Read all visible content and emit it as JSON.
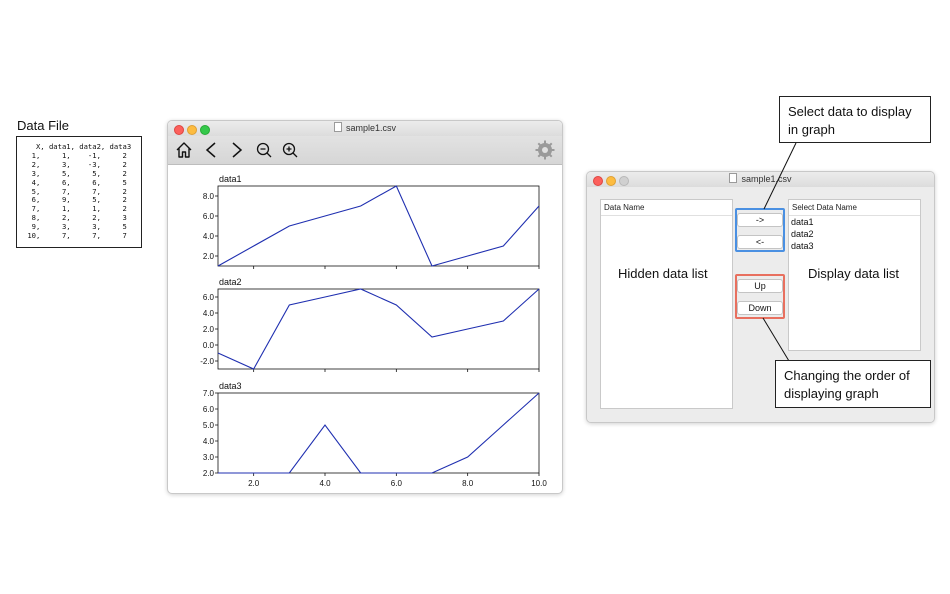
{
  "data_file": {
    "title": "Data File",
    "content": "   X, data1, data2, data3\n  1,     1,    -1,     2\n  2,     3,    -3,     2\n  3,     5,     5,     2\n  4,     6,     6,     5\n  5,     7,     7,     2\n  6,     9,     5,     2\n  7,     1,     1,     2\n  8,     2,     2,     3\n  9,     3,     3,     5\n 10,     7,     7,     7"
  },
  "graph_window": {
    "title": "sample1.csv",
    "toolbar": [
      "home-icon",
      "back-icon",
      "forward-icon",
      "zoom-out-icon",
      "zoom-in-icon",
      "gear-icon"
    ],
    "line_color": "#1f2fb0"
  },
  "chart_data": [
    {
      "type": "line",
      "title": "data1",
      "x": [
        1,
        2,
        3,
        4,
        5,
        6,
        7,
        8,
        9,
        10
      ],
      "values": [
        1,
        3,
        5,
        6,
        7,
        9,
        1,
        2,
        3,
        7
      ],
      "ylim": [
        1,
        9
      ],
      "yticks": [
        "2.0",
        "4.0",
        "6.0",
        "8.0"
      ],
      "ytick_values": [
        2,
        4,
        6,
        8
      ]
    },
    {
      "type": "line",
      "title": "data2",
      "x": [
        1,
        2,
        3,
        4,
        5,
        6,
        7,
        8,
        9,
        10
      ],
      "values": [
        -1,
        -3,
        5,
        6,
        7,
        5,
        1,
        2,
        3,
        7
      ],
      "ylim": [
        -3,
        7
      ],
      "yticks": [
        "-2.0",
        "0.0",
        "2.0",
        "4.0",
        "6.0"
      ],
      "ytick_values": [
        -2,
        0,
        2,
        4,
        6
      ]
    },
    {
      "type": "line",
      "title": "data3",
      "x": [
        1,
        2,
        3,
        4,
        5,
        6,
        7,
        8,
        9,
        10
      ],
      "values": [
        2,
        2,
        2,
        5,
        2,
        2,
        2,
        3,
        5,
        7
      ],
      "ylim": [
        2,
        7
      ],
      "yticks": [
        "2.0",
        "3.0",
        "4.0",
        "5.0",
        "6.0",
        "7.0"
      ],
      "ytick_values": [
        2,
        3,
        4,
        5,
        6,
        7
      ],
      "xticks": [
        "2.0",
        "4.0",
        "6.0",
        "8.0",
        "10.0"
      ],
      "xtick_values": [
        2,
        4,
        6,
        8,
        10
      ]
    }
  ],
  "select_window": {
    "title": "sample1.csv",
    "hidden_list": {
      "header": "Data Name",
      "placeholder": "Hidden data list"
    },
    "display_list": {
      "header": "Select Data Name",
      "items": [
        "data1",
        "data2",
        "data3"
      ],
      "placeholder": "Display data list"
    },
    "buttons": {
      "add": "->",
      "remove": "<-",
      "up": "Up",
      "down": "Down"
    }
  },
  "callouts": {
    "top": "Select data to display in graph",
    "bottom": "Changing the order of displaying graph"
  },
  "colors": {
    "blue_highlight": "#4a90e2",
    "red_highlight": "#e8705f"
  }
}
